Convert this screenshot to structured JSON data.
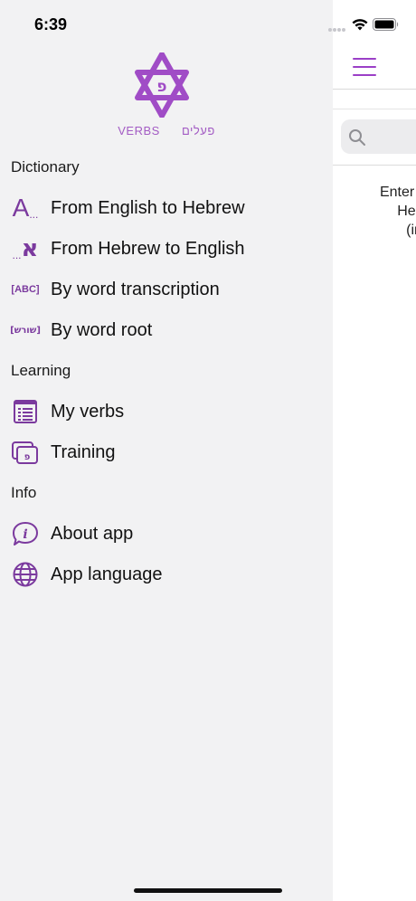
{
  "status": {
    "time": "6:39"
  },
  "brand": {
    "left": "VERBS",
    "right": "פעלים"
  },
  "logo": {
    "letter": "פ"
  },
  "sections": {
    "dictionary": "Dictionary",
    "learning": "Learning",
    "info": "Info"
  },
  "items": {
    "eng_heb": {
      "label": "From English to Hebrew",
      "icon": "A..."
    },
    "heb_eng": {
      "label": "From Hebrew to English",
      "icon": "...א"
    },
    "transcription": {
      "label": "By word transcription",
      "icon": "[ABC]"
    },
    "root": {
      "label": "By word root",
      "icon": "[שורש]"
    },
    "my_verbs": {
      "label": "My verbs",
      "icon": "list-icon"
    },
    "training": {
      "label": "Training",
      "icon": "cards-icon"
    },
    "about": {
      "label": "About app",
      "icon": "info-icon"
    },
    "language": {
      "label": "App language",
      "icon": "globe-icon"
    }
  },
  "main": {
    "hint_line1": "Enter th",
    "hint_line2": "Hebre",
    "hint_line3": "(in"
  },
  "colors": {
    "accent": "#9b3fc7",
    "icon": "#7b3a9e",
    "drawer_bg": "#f2f2f3"
  }
}
